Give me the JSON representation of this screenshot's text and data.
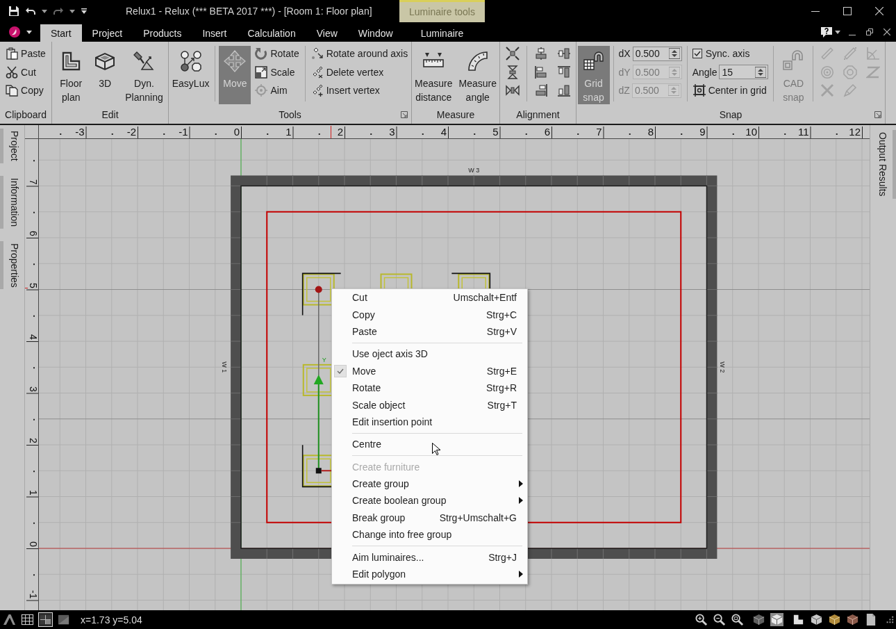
{
  "window": {
    "title": "Relux1 - Relux (*** BETA 2017 ***) - [Room 1: Floor plan]"
  },
  "contextual_tab_group": {
    "label": "Luminaire tools",
    "tabs": [
      {
        "label": "Luminaire",
        "selected": false
      }
    ]
  },
  "menu_tabs": [
    {
      "label": "Start",
      "selected": true
    },
    {
      "label": "Project",
      "selected": false
    },
    {
      "label": "Products",
      "selected": false
    },
    {
      "label": "Insert",
      "selected": false
    },
    {
      "label": "Calculation",
      "selected": false
    },
    {
      "label": "View",
      "selected": false
    },
    {
      "label": "Window",
      "selected": false
    }
  ],
  "ribbon": {
    "groups": [
      {
        "label": "Clipboard",
        "launcher": false,
        "sections": [
          {
            "items": [
              {
                "kind": "small",
                "label": "Paste",
                "pressed": false,
                "disabled": false
              },
              {
                "kind": "small",
                "label": "Cut",
                "pressed": false,
                "disabled": false
              },
              {
                "kind": "small",
                "label": "Copy",
                "pressed": false,
                "disabled": false
              }
            ]
          }
        ]
      },
      {
        "label": "Edit",
        "launcher": false,
        "sections": [
          {
            "items": [
              {
                "kind": "large",
                "label": "Floor plan",
                "pressed": false,
                "disabled": false
              },
              {
                "kind": "large",
                "label": "3D",
                "pressed": false,
                "disabled": false
              },
              {
                "kind": "large",
                "label": "Dyn. Planning",
                "pressed": false,
                "disabled": false
              }
            ]
          }
        ]
      },
      {
        "label": "Tools",
        "launcher": true,
        "sections": [
          {
            "items": [
              {
                "kind": "large",
                "label": "EasyLux",
                "pressed": false,
                "disabled": false
              }
            ]
          },
          {
            "items": [
              {
                "kind": "large",
                "label": "Move",
                "pressed": true,
                "disabled": false
              },
              {
                "kind": "small",
                "label": "Rotate",
                "pressed": false,
                "disabled": false
              },
              {
                "kind": "small",
                "label": "Scale",
                "pressed": false,
                "disabled": false
              },
              {
                "kind": "small",
                "label": "Aim",
                "pressed": false,
                "disabled": false
              }
            ]
          },
          {
            "items": [
              {
                "kind": "small",
                "label": "Rotate around axis",
                "pressed": false,
                "disabled": false
              },
              {
                "kind": "small",
                "label": "Delete vertex",
                "pressed": false,
                "disabled": false
              },
              {
                "kind": "small",
                "label": "Insert vertex",
                "pressed": false,
                "disabled": false
              }
            ]
          }
        ]
      },
      {
        "label": "Measure",
        "launcher": false,
        "sections": [
          {
            "items": [
              {
                "kind": "large",
                "label": "Measure distance",
                "pressed": false,
                "disabled": false
              },
              {
                "kind": "large",
                "label": "Measure angle",
                "pressed": false,
                "disabled": false
              }
            ]
          }
        ]
      },
      {
        "label": "Alignment",
        "launcher": false,
        "sections": [
          {
            "items": [
              {
                "kind": "icon",
                "disabled": false
              },
              {
                "kind": "icon",
                "disabled": false
              },
              {
                "kind": "icon",
                "disabled": false
              }
            ]
          },
          {
            "items": [
              {
                "kind": "icon",
                "disabled": false
              },
              {
                "kind": "icon",
                "disabled": false
              },
              {
                "kind": "icon",
                "disabled": false
              },
              {
                "kind": "icon",
                "disabled": false
              },
              {
                "kind": "icon",
                "disabled": false
              },
              {
                "kind": "icon",
                "disabled": false
              }
            ]
          }
        ]
      },
      {
        "label": "Snap",
        "launcher": true,
        "sections": [
          {
            "items": [
              {
                "kind": "large",
                "label": "Grid snap",
                "pressed": true,
                "disabled": false
              }
            ]
          },
          {
            "items": [
              {
                "kind": "field",
                "label": "dX",
                "value": "0.500",
                "disabled": false
              },
              {
                "kind": "field",
                "label": "dY",
                "value": "0.500",
                "disabled": true
              },
              {
                "kind": "field",
                "label": "dZ",
                "value": "0.500",
                "disabled": true
              }
            ]
          },
          {
            "items": [
              {
                "kind": "checkbox",
                "label": "Sync. axis",
                "checked": true
              },
              {
                "kind": "field",
                "label": "Angle",
                "value": "15",
                "disabled": false
              },
              {
                "kind": "small",
                "label": "Center in grid",
                "pressed": false,
                "disabled": false
              }
            ]
          },
          {
            "items": [
              {
                "kind": "large",
                "label": "CAD snap",
                "pressed": false,
                "disabled": true
              }
            ]
          },
          {
            "items": [
              {
                "kind": "icon",
                "disabled": true
              },
              {
                "kind": "icon",
                "disabled": true
              },
              {
                "kind": "icon",
                "disabled": true
              },
              {
                "kind": "icon",
                "disabled": true
              },
              {
                "kind": "icon",
                "disabled": true
              },
              {
                "kind": "icon",
                "disabled": true
              },
              {
                "kind": "icon",
                "disabled": true
              },
              {
                "kind": "icon",
                "disabled": true
              }
            ]
          }
        ]
      }
    ]
  },
  "side_panels": {
    "left": [
      {
        "label": "Project"
      },
      {
        "label": "Information"
      },
      {
        "label": "Properties"
      }
    ],
    "right": [
      {
        "label": "Output Results"
      }
    ]
  },
  "rulers": {
    "horizontal": [
      "-3",
      "-2",
      "-1",
      "0",
      "1",
      "2",
      "3",
      "4",
      "5",
      "6",
      "7",
      "8",
      "9",
      "10",
      "11",
      "12"
    ],
    "vertical": [
      "7",
      "6",
      "5",
      "4",
      "3",
      "2",
      "1",
      "0",
      "-1"
    ]
  },
  "floor_plan": {
    "wall_labels": [
      "W 3",
      "W 1",
      "W 2"
    ],
    "gizmo_axis_label": "Y"
  },
  "context_menu": {
    "sections": [
      {
        "items": [
          {
            "label": "Cut",
            "shortcut": "Umschalt+Entf",
            "checked": false,
            "disabled": false,
            "submenu": false
          },
          {
            "label": "Copy",
            "shortcut": "Strg+C",
            "checked": false,
            "disabled": false,
            "submenu": false
          },
          {
            "label": "Paste",
            "shortcut": "Strg+V",
            "checked": false,
            "disabled": false,
            "submenu": false
          }
        ]
      },
      {
        "items": [
          {
            "label": "Use oject axis 3D",
            "checked": false,
            "disabled": false,
            "submenu": false
          },
          {
            "label": "Move",
            "shortcut": "Strg+E",
            "checked": true,
            "disabled": false,
            "submenu": false
          },
          {
            "label": "Rotate",
            "shortcut": "Strg+R",
            "checked": false,
            "disabled": false,
            "submenu": false
          },
          {
            "label": "Scale object",
            "shortcut": "Strg+T",
            "checked": false,
            "disabled": false,
            "submenu": false
          },
          {
            "label": "Edit insertion point",
            "checked": false,
            "disabled": false,
            "submenu": false
          }
        ]
      },
      {
        "items": [
          {
            "label": "Centre",
            "checked": false,
            "disabled": false,
            "submenu": false
          }
        ]
      },
      {
        "items": [
          {
            "label": "Create furniture",
            "checked": false,
            "disabled": true,
            "submenu": false
          },
          {
            "label": "Create group",
            "checked": false,
            "disabled": false,
            "submenu": true
          },
          {
            "label": "Create boolean group",
            "checked": false,
            "disabled": false,
            "submenu": true
          },
          {
            "label": "Break group",
            "shortcut": "Strg+Umschalt+G",
            "checked": false,
            "disabled": false,
            "submenu": false
          },
          {
            "label": "Change into free group",
            "checked": false,
            "disabled": false,
            "submenu": false
          }
        ]
      },
      {
        "items": [
          {
            "label": "Aim luminaires...",
            "shortcut": "Strg+J",
            "checked": false,
            "disabled": false,
            "submenu": false
          },
          {
            "label": "Edit polygon",
            "checked": false,
            "disabled": false,
            "submenu": true
          }
        ]
      }
    ]
  },
  "status_bar": {
    "display_modes": [
      {
        "selected": false
      },
      {
        "selected": true
      },
      {
        "selected": false
      }
    ],
    "coordinates": "x=1.73 y=5.04",
    "view_modes": [
      {
        "selected": false
      },
      {
        "selected": true
      },
      {
        "selected": false
      },
      {
        "selected": false
      },
      {
        "selected": false
      },
      {
        "selected": false
      }
    ]
  }
}
